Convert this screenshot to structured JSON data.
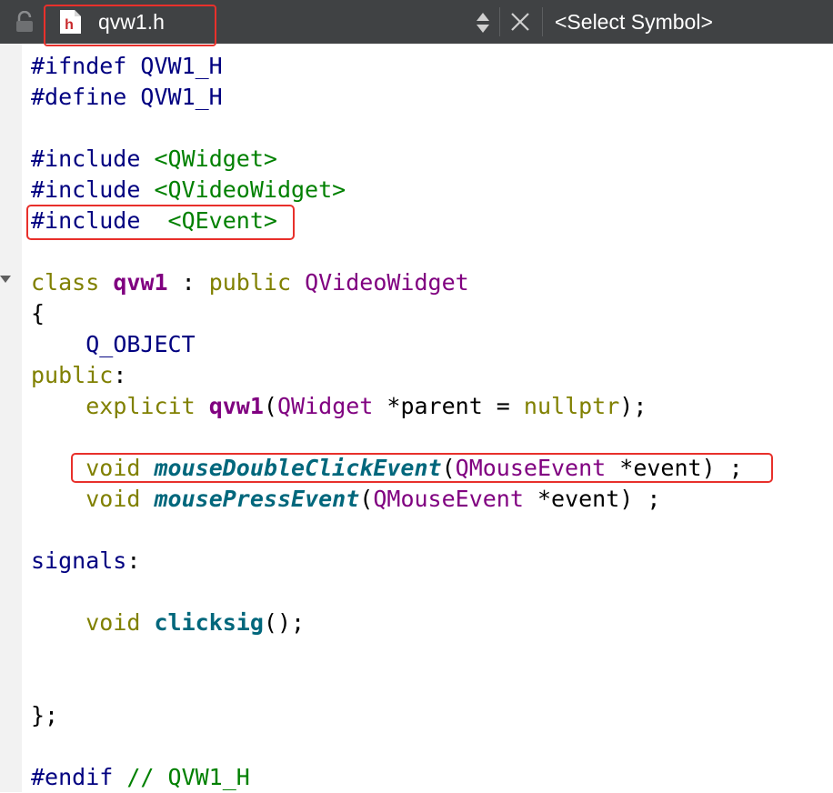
{
  "toolbar": {
    "file_name": "qvw1.h",
    "file_type_badge": "h",
    "symbol_selector": "<Select Symbol>",
    "icons": [
      "lock-icon",
      "header-file-icon",
      "sort-arrows-icon",
      "close-icon"
    ]
  },
  "colors": {
    "toolbar_bg": "#404244",
    "highlight": "#e8302b",
    "preprocessor": "#000080",
    "string_include": "#008000",
    "keyword": "#808000",
    "type": "#800080",
    "function": "#00677c"
  },
  "code": {
    "l1": {
      "directive": "#ifndef",
      "name": "QVW1_H"
    },
    "l2": {
      "directive": "#define",
      "name": "QVW1_H"
    },
    "l4": {
      "directive": "#include",
      "header": "<QWidget>"
    },
    "l5": {
      "directive": "#include",
      "header": "<QVideoWidget>"
    },
    "l6": {
      "directive": "#include",
      "header": "<QEvent>"
    },
    "l8": {
      "kw_class": "class",
      "name": "qvw1",
      "colon": " : ",
      "kw_public": "public",
      "base": "QVideoWidget"
    },
    "l9": "{",
    "l10": "Q_OBJECT",
    "l11": {
      "kw": "public",
      "colon": ":"
    },
    "l12": {
      "kw": "explicit",
      "name": "qvw1",
      "open": "(",
      "type": "QWidget",
      "param": " *parent = ",
      "null": "nullptr",
      "close": ");"
    },
    "l14": {
      "kw": "void",
      "fn": "mouseDoubleClickEvent",
      "open": "(",
      "type": "QMouseEvent",
      "param": " *event) ;"
    },
    "l15": {
      "kw": "void",
      "fn": "mousePressEvent",
      "open": "(",
      "type": "QMouseEvent",
      "param": " *event) ;"
    },
    "l17": {
      "kw": "signals",
      "colon": ":"
    },
    "l19": {
      "kw": "void",
      "fn": "clicksig",
      "rest": "();"
    },
    "l22": "};",
    "l24": {
      "directive": "#endif",
      "comment": "// QVW1_H"
    }
  }
}
